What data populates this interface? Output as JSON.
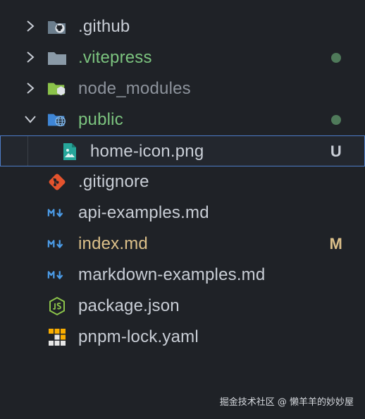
{
  "explorer": {
    "items": [
      {
        "label": ".github",
        "kind": "folder",
        "expanded": false,
        "icon": "github-folder-icon",
        "status": ""
      },
      {
        "label": ".vitepress",
        "kind": "folder",
        "expanded": false,
        "icon": "folder-icon",
        "status": "dot"
      },
      {
        "label": "node_modules",
        "kind": "folder",
        "expanded": false,
        "icon": "node-folder-icon",
        "status": ""
      },
      {
        "label": "public",
        "kind": "folder",
        "expanded": true,
        "icon": "public-folder-icon",
        "status": "dot"
      },
      {
        "label": "home-icon.png",
        "kind": "file",
        "icon": "image-file-icon",
        "status": "U"
      },
      {
        "label": ".gitignore",
        "kind": "file",
        "icon": "git-icon",
        "status": ""
      },
      {
        "label": "api-examples.md",
        "kind": "file",
        "icon": "markdown-icon",
        "status": ""
      },
      {
        "label": "index.md",
        "kind": "file",
        "icon": "markdown-icon",
        "status": "M"
      },
      {
        "label": "markdown-examples.md",
        "kind": "file",
        "icon": "markdown-icon",
        "status": ""
      },
      {
        "label": "package.json",
        "kind": "file",
        "icon": "nodejs-icon",
        "status": ""
      },
      {
        "label": "pnpm-lock.yaml",
        "kind": "file",
        "icon": "pnpm-icon",
        "status": ""
      }
    ]
  },
  "colors": {
    "background": "#1f2227",
    "selection_border": "#4d7cc7",
    "git_added_text": "#7cc47f",
    "git_modified_text": "#dcc08a",
    "ignored_text": "#8d939c",
    "status_dot": "#4f7a5a"
  },
  "watermark": "掘金技术社区 @ 懒羊羊的妙妙屋"
}
